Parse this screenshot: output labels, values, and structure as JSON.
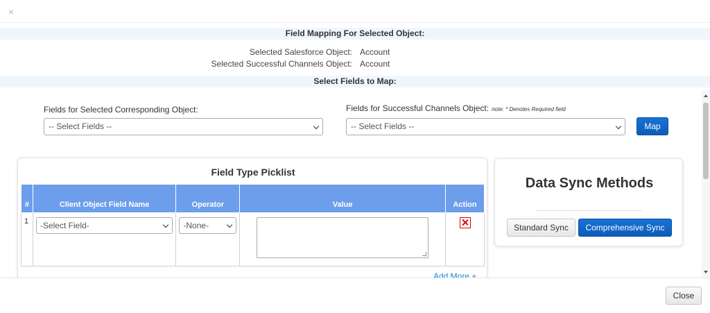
{
  "modal": {
    "close_icon": "×",
    "section1_title": "Field Mapping For Selected Object:",
    "salesforce_label": "Selected Salesforce Object:",
    "salesforce_value": "Account",
    "channels_label": "Selected Successful Channels Object:",
    "channels_value": "Account",
    "section2_title": "Select Fields to Map:"
  },
  "mapping": {
    "left_label": "Fields for Selected Corresponding Object:",
    "left_select": "-- Select Fields --",
    "right_label": "Fields for Successful Channels Object:",
    "right_note": "note: * Denotes Required field",
    "right_select": "-- Select Fields --",
    "map_button": "Map"
  },
  "picklist": {
    "title": "Field Type Picklist",
    "columns": [
      "#",
      "Client Object Field Name",
      "Operator",
      "Value",
      "Action"
    ],
    "rows": [
      {
        "num": "1",
        "field": "-Select Field-",
        "operator": "-None-",
        "value": ""
      }
    ],
    "add_more": "Add More +"
  },
  "sync": {
    "title": "Data Sync Methods",
    "standard_button": "Standard Sync",
    "comprehensive_button": "Comprehensive Sync"
  },
  "footer": {
    "close_button": "Close"
  },
  "colors": {
    "accent": "#0b5cb8",
    "table_header": "#6d9eeb",
    "band": "#f0f6fc",
    "delete": "#dd0000"
  },
  "icons": {
    "close": "close-icon",
    "delete": "delete-icon",
    "dropdown": "chevron-down-icon"
  }
}
